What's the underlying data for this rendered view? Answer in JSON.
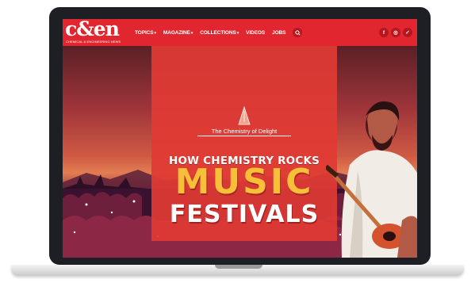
{
  "site": {
    "logo_text": "c&en",
    "logo_subtitle": "CHEMICAL & ENGINEERING NEWS"
  },
  "nav": {
    "items": [
      {
        "label": "TOPICS",
        "dropdown": true
      },
      {
        "label": "MAGAZINE",
        "dropdown": true
      },
      {
        "label": "COLLECTIONS",
        "dropdown": true
      },
      {
        "label": "VIDEOS",
        "dropdown": false
      },
      {
        "label": "JOBS",
        "dropdown": false
      }
    ],
    "search_icon": "search-icon",
    "social": [
      {
        "icon": "facebook-icon",
        "glyph": "f"
      },
      {
        "icon": "instagram-icon",
        "glyph": "◎"
      },
      {
        "icon": "twitter-icon",
        "glyph": "✓"
      }
    ]
  },
  "hero": {
    "series_label": "The Chemistry of Delight",
    "headline_line1": "HOW CHEMISTRY ROCKS",
    "headline_line2": "MUSIC",
    "headline_line3": "FESTIVALS"
  },
  "colors": {
    "brand_red": "#e2262f",
    "headline_yellow": "#f8c038",
    "laptop_frame": "#1d1f24"
  }
}
